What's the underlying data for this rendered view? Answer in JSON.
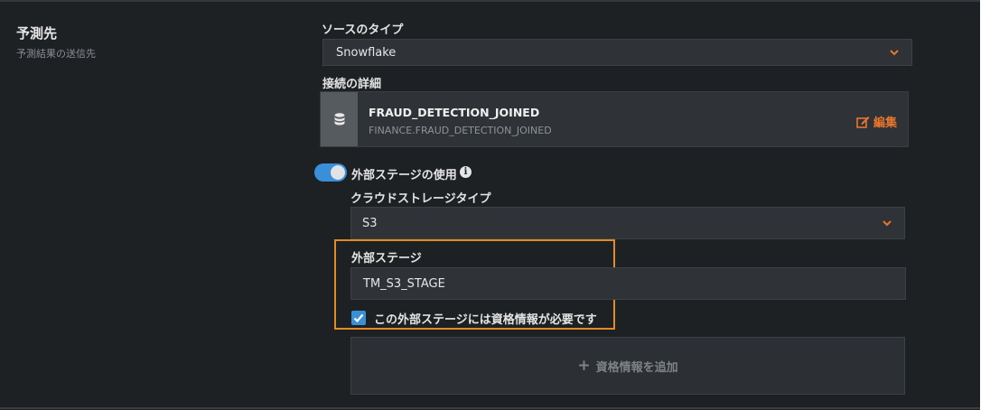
{
  "section": {
    "title": "予測先",
    "subtitle": "予測結果の送信先"
  },
  "source_type": {
    "label": "ソースのタイプ",
    "value": "Snowflake"
  },
  "connection": {
    "label": "接続の詳細",
    "name": "FRAUD_DETECTION_JOINED",
    "path": "FINANCE.FRAUD_DETECTION_JOINED",
    "edit_label": "編集",
    "icon": "database-icon"
  },
  "external_stage_toggle": {
    "label": "外部ステージの使用",
    "enabled": true,
    "info_glyph": "i"
  },
  "cloud_storage": {
    "label": "クラウドストレージタイプ",
    "value": "S3"
  },
  "external_stage": {
    "label": "外部ステージ",
    "value": "TM_S3_STAGE"
  },
  "credentials_checkbox": {
    "label": "この外部ステージには資格情報が必要です",
    "checked": true
  },
  "add_credentials": {
    "label": "資格情報を追加"
  },
  "colors": {
    "accent_orange": "#e8762c",
    "toggle_blue": "#3a8fd9",
    "background": "#1e2124",
    "field": "#2f3337"
  }
}
